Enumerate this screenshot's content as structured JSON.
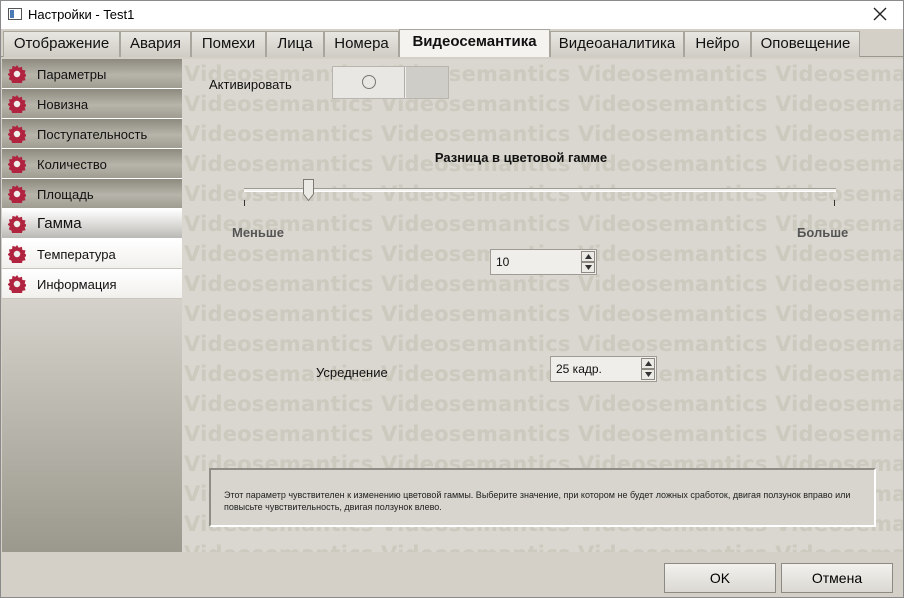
{
  "window": {
    "title": "Настройки - Test1"
  },
  "tabs": [
    {
      "label": "Отображение"
    },
    {
      "label": "Авария"
    },
    {
      "label": "Помехи"
    },
    {
      "label": "Лица"
    },
    {
      "label": "Номера"
    },
    {
      "label": "Видеосемантика",
      "active": true
    },
    {
      "label": "Видеоаналитика"
    },
    {
      "label": "Нейро"
    },
    {
      "label": "Оповещение"
    }
  ],
  "sidebar": {
    "items": [
      {
        "label": "Параметры"
      },
      {
        "label": "Новизна"
      },
      {
        "label": "Поступательность"
      },
      {
        "label": "Количество"
      },
      {
        "label": "Площадь"
      },
      {
        "label": "Гамма",
        "selected": true
      },
      {
        "label": "Температура"
      },
      {
        "label": "Информация"
      }
    ],
    "icon": "gear-icon",
    "icon_color": "#b0243f"
  },
  "content": {
    "watermark_text": "Videosemantics Videosemantics Videosemantics Videosemantics",
    "activate_label": "Активировать",
    "activate_on": false,
    "section_title": "Разница в цветовой гамме",
    "slider_level": 0.11,
    "range_min_label": "Меньше",
    "range_max_label": "Больше",
    "threshold_value": "10",
    "averaging_label": "Усреднение",
    "averaging_value": "25 кадр.",
    "info_text": "Этот параметр чувствителен к изменению цветовой гаммы. Выберите значение, при котором не будет ложных сработок, двигая ползунок вправо или повысьте чувствительность, двигая ползунок влево."
  },
  "footer": {
    "ok_label": "OK",
    "cancel_label": "Отмена"
  }
}
